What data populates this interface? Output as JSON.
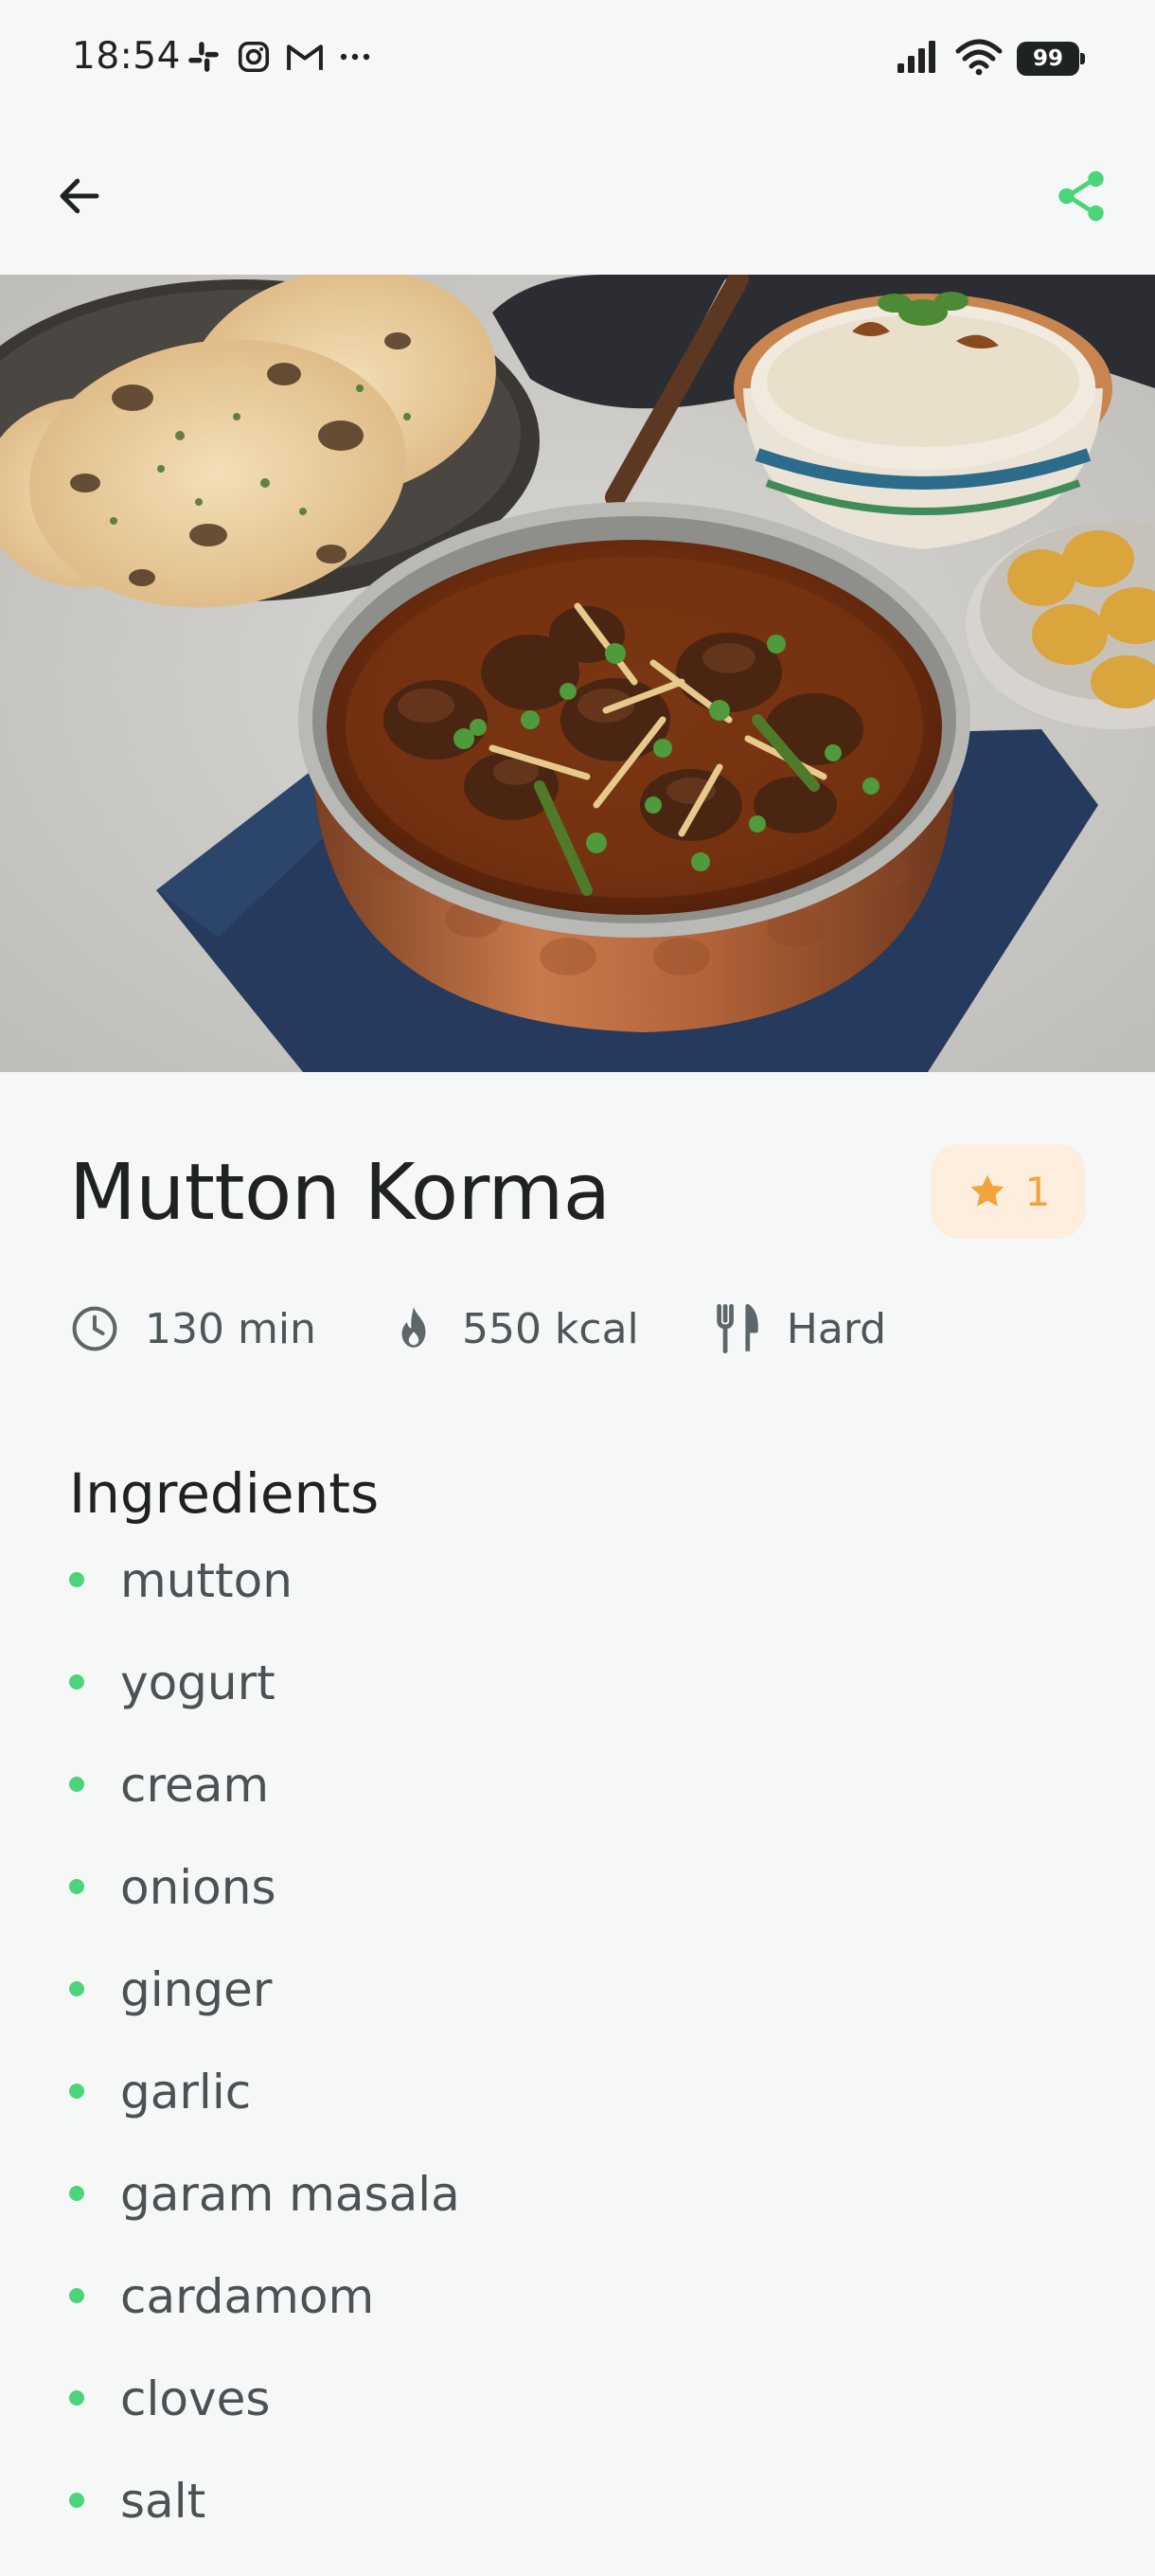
{
  "status_bar": {
    "time": "18:54",
    "battery": "99",
    "left_icons": [
      "slack-icon",
      "instagram-icon",
      "gmail-icon",
      "more-dots-icon"
    ],
    "right_icons": [
      "signal-icon",
      "wifi-icon",
      "battery-icon"
    ]
  },
  "app_bar": {
    "back_icon": "arrow-back-icon",
    "share_icon": "share-icon",
    "accent_color": "#4cd47a"
  },
  "hero": {
    "image": "mutton-korma-photo"
  },
  "recipe": {
    "title": "Mutton Korma",
    "rating": "1",
    "rating_icon": "star-icon",
    "rating_color": "#f2a33a",
    "meta": {
      "time": "130 min",
      "calories": "550 kcal",
      "difficulty": "Hard"
    }
  },
  "ingredients": {
    "title": "Ingredients",
    "items": [
      "mutton",
      "yogurt",
      "cream",
      "onions",
      "ginger",
      "garlic",
      "garam masala",
      "cardamom",
      "cloves",
      "salt"
    ]
  }
}
